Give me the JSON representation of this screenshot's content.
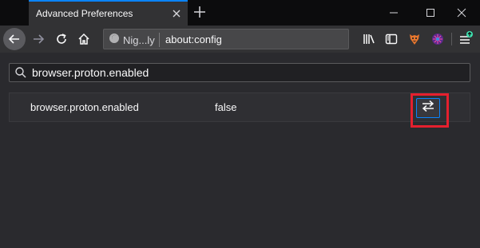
{
  "tab": {
    "title": "Advanced Preferences"
  },
  "urlbar": {
    "identity_label": "Nig...ly",
    "url": "about:config"
  },
  "search": {
    "value": "browser.proton.enabled"
  },
  "preference": {
    "name": "browser.proton.enabled",
    "value": "false"
  },
  "colors": {
    "accent": "#0a84ff",
    "highlight_box": "#e5202e",
    "update_badge": "#3fe1b0"
  },
  "icons": {
    "tab_close": "close-icon",
    "new_tab": "plus-icon",
    "back": "arrow-left-icon",
    "forward": "arrow-right-icon",
    "reload": "reload-icon",
    "home": "home-icon",
    "library": "library-icon",
    "sidebar": "sidebar-icon",
    "ext1": "extension-icon",
    "ext2": "extension-icon",
    "menu": "hamburger-menu-icon",
    "search": "search-icon",
    "toggle": "toggle-arrows-icon"
  }
}
